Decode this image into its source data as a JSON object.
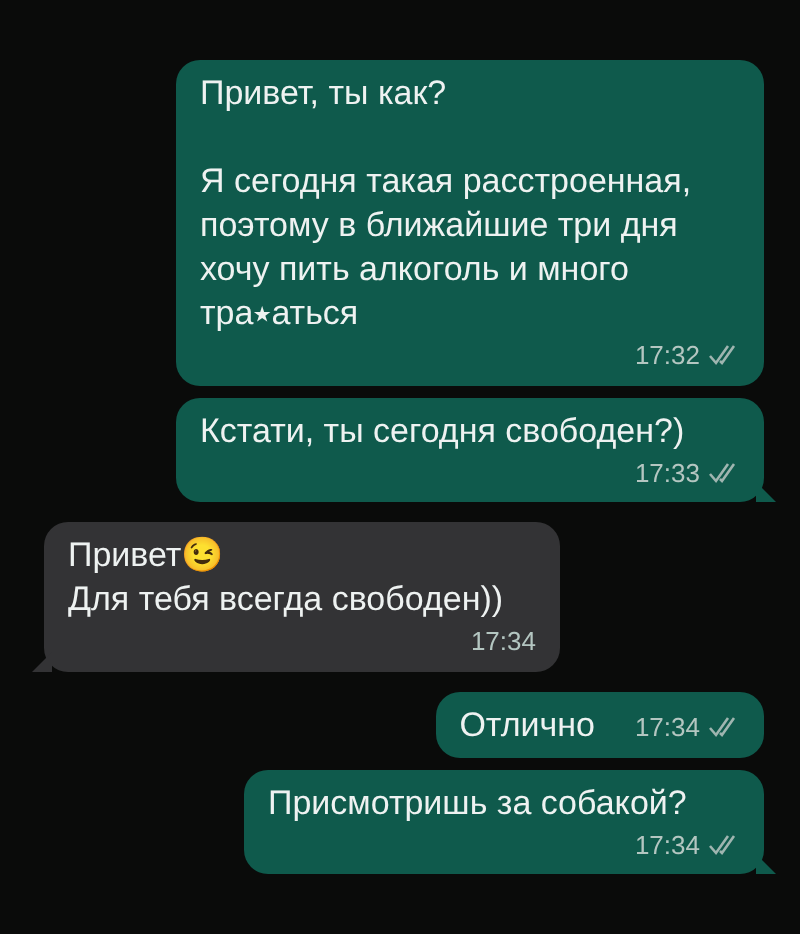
{
  "messages": [
    {
      "kind": "out",
      "text": "Привет, ты как?\n\nЯ сегодня такая расстроенная, поэтому в ближайшие три дня хочу пить алкоголь и много тра⭑аться",
      "time": "17:32",
      "read": false,
      "tail": false
    },
    {
      "kind": "out",
      "text": "Кстати, ты сегодня свободен?)",
      "time": "17:33",
      "read": false,
      "tail": true
    },
    {
      "kind": "in",
      "text": "Привет😉\nДля тебя всегда свободен))",
      "time": "17:34",
      "tail": true
    },
    {
      "kind": "out",
      "text": "Отлично",
      "time": "17:34",
      "read": false,
      "tail": false
    },
    {
      "kind": "out",
      "text": "Присмотришь за собакой?",
      "time": "17:34",
      "read": false,
      "tail": true
    }
  ]
}
